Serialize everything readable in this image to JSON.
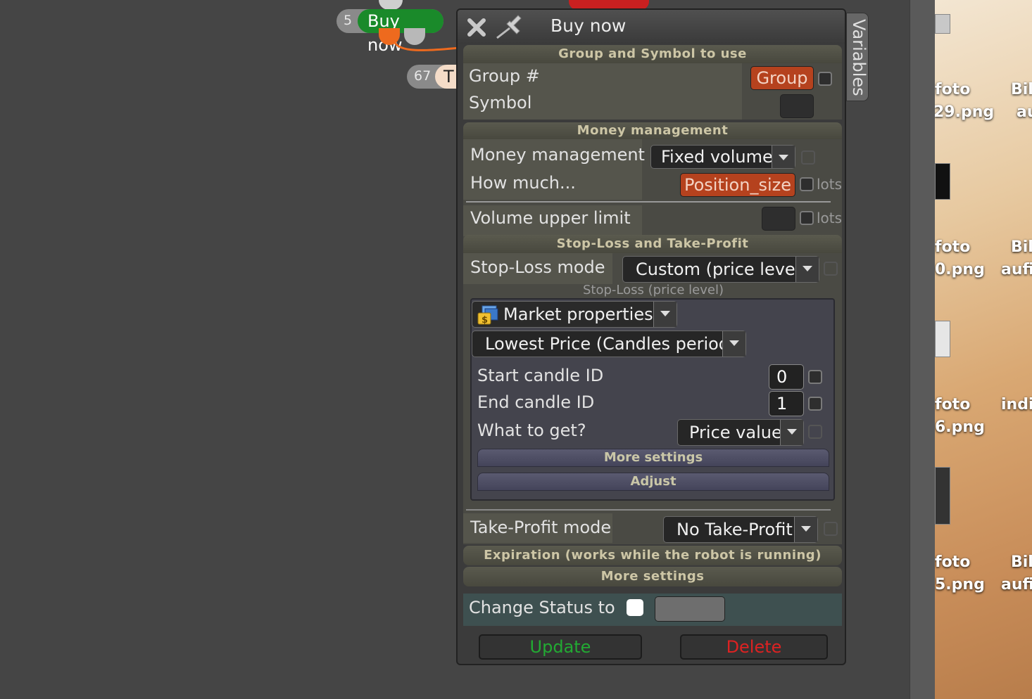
{
  "canvas": {
    "node_buy": {
      "number": "5",
      "label": "Buy now"
    },
    "node_t": {
      "number": "67",
      "label": "T"
    }
  },
  "dialog": {
    "title": "Buy now",
    "variables_tab": "Variables",
    "group_section": {
      "header": "Group and Symbol to use",
      "group_label": "Group #",
      "group_button": "Group",
      "symbol_label": "Symbol"
    },
    "money_section": {
      "header": "Money management",
      "mm_label": "Money management",
      "mm_value": "Fixed volume",
      "how_much_label": "How much...",
      "how_much_button": "Position_size",
      "unit_lots": "lots",
      "volume_limit_label": "Volume upper limit"
    },
    "sltp_section": {
      "header": "Stop-Loss and Take-Profit",
      "sl_mode_label": "Stop-Loss mode",
      "sl_mode_value": "Custom (price level)",
      "sl_sublabel": "Stop-Loss (price level)",
      "market_properties": "Market properties",
      "lowest_price": "Lowest Price (Candles period)",
      "start_candle_label": "Start candle ID",
      "start_candle_value": "0",
      "end_candle_label": "End candle ID",
      "end_candle_value": "1",
      "what_to_get_label": "What to get?",
      "what_to_get_value": "Price value",
      "more_settings": "More settings",
      "adjust": "Adjust",
      "tp_mode_label": "Take-Profit mode",
      "tp_mode_value": "No Take-Profit"
    },
    "expiration_header": "Expiration (works while the robot is running)",
    "more_settings_header": "More settings",
    "change_status_label": "Change Status to",
    "update_button": "Update",
    "delete_button": "Delete"
  },
  "desktop": {
    "files": [
      {
        "line1": "foto",
        "line2": "29.png"
      },
      {
        "line1": "Bil",
        "line2": "aufi"
      },
      {
        "line1": "foto",
        "line2": "0.png"
      },
      {
        "line1": "Bil",
        "line2": "aufi"
      },
      {
        "line1": "foto",
        "line2": "6.png"
      },
      {
        "line1": "indi",
        "line2": ""
      },
      {
        "line1": "foto",
        "line2": "5.png"
      },
      {
        "line1": "Bil",
        "line2": "aufi"
      }
    ]
  },
  "colors": {
    "accent_orange": "#b5421e",
    "update_green": "#22aa33",
    "delete_red": "#dd2222",
    "node_green": "#1a8a2a"
  }
}
